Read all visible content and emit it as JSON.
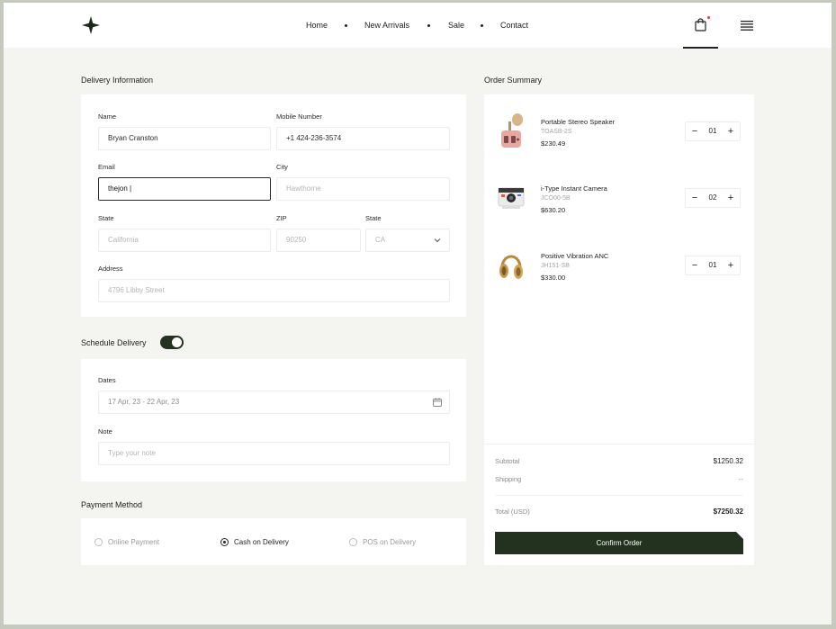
{
  "nav": {
    "links": [
      "Home",
      "New Arrivals",
      "Sale",
      "Contact"
    ]
  },
  "icons": {
    "logo": "four-point-star-icon",
    "cart": "shopping-bag-icon",
    "menu": "hamburger-menu-icon"
  },
  "colors": {
    "accent": "#23311f",
    "notification": "#d9443a",
    "page_bg": "#f4f4f1"
  },
  "delivery": {
    "title": "Delivery Information",
    "name_label": "Name",
    "name_value": "Bryan Cranston",
    "mobile_label": "Mobile Number",
    "mobile_value": "+1  424-236-3574",
    "email_label": "Email",
    "email_value": "thejon |",
    "city_label": "City",
    "city_placeholder": "Hawthorne",
    "state_label": "State",
    "state_placeholder": "California",
    "zip_label": "ZIP",
    "zip_placeholder": "90250",
    "state2_label": "State",
    "state2_value": "CA",
    "address_label": "Address",
    "address_placeholder": "4796 Libby Street"
  },
  "schedule": {
    "title": "Schedule Delivery",
    "enabled": true,
    "dates_label": "Dates",
    "dates_value": "17 Apr, 23 - 22 Apr, 23",
    "note_label": "Note",
    "note_placeholder": "Type your note"
  },
  "payment": {
    "title": "Payment Method",
    "options": [
      "Online Payment",
      "Cash on Delivery",
      "POS on Delivery"
    ],
    "selected": "Cash on Delivery"
  },
  "order": {
    "title": "Order Summary",
    "items": [
      {
        "name": "Portable Stereo Speaker",
        "sku": "TOASB-2S",
        "price": "$230.49",
        "qty": "01"
      },
      {
        "name": "i-Type Instant Camera",
        "sku": "JCO00-5B",
        "price": "$630.20",
        "qty": "02"
      },
      {
        "name": "Positive Vibration ANC",
        "sku": "JH151-SB",
        "price": "$330.00",
        "qty": "01"
      }
    ],
    "subtotal_label": "Subtotal",
    "subtotal_value": "$1250.32",
    "shipping_label": "Shipping",
    "shipping_value": "--",
    "total_label": "Total (USD)",
    "total_value": "$7250.32",
    "confirm_label": "Confirm Order"
  }
}
